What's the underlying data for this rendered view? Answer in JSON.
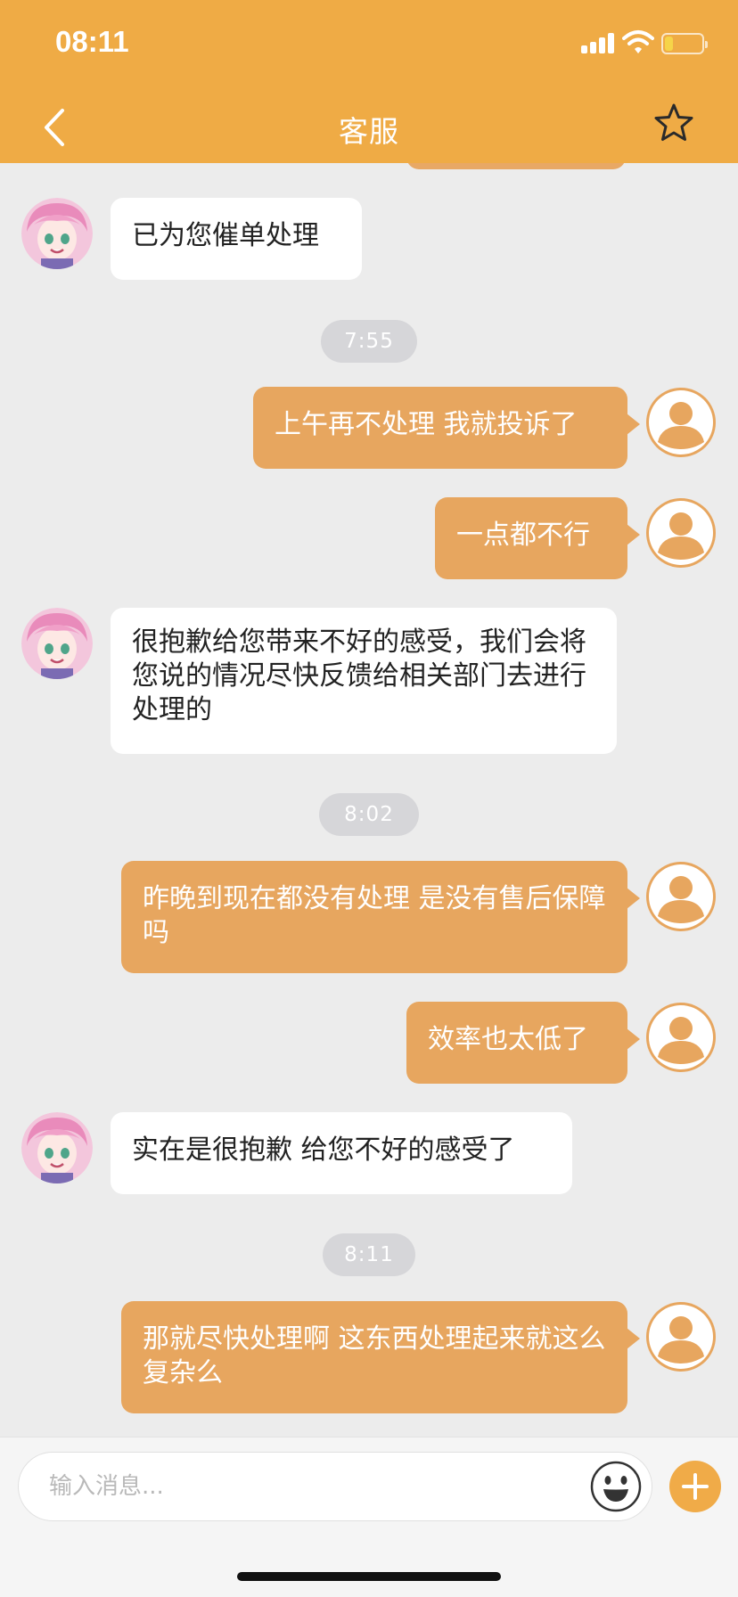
{
  "status": {
    "time": "08:11"
  },
  "header": {
    "title": "客服"
  },
  "colors": {
    "accent": "#efab45",
    "out_bubble": "#e7a65f",
    "in_bubble": "#ffffff",
    "background": "#ececec"
  },
  "icons": {
    "back": "chevron-left-icon",
    "favorite": "star-icon",
    "emoji": "smiley-icon",
    "add": "plus-icon"
  },
  "messages": [
    {
      "from": "agent",
      "text": "已为您催单处理"
    },
    {
      "time": "7:55"
    },
    {
      "from": "user",
      "text": "上午再不处理 我就投诉了"
    },
    {
      "from": "user",
      "text": "一点都不行"
    },
    {
      "from": "agent",
      "text": "很抱歉给您带来不好的感受，我们会将您说的情况尽快反馈给相关部门去进行处理的"
    },
    {
      "time": "8:02"
    },
    {
      "from": "user",
      "text": "昨晚到现在都没有处理 是没有售后保障吗"
    },
    {
      "from": "user",
      "text": "效率也太低了"
    },
    {
      "from": "agent",
      "text": "实在是很抱歉 给您不好的感受了"
    },
    {
      "time": "8:11"
    },
    {
      "from": "user",
      "text": "那就尽快处理啊 这东西处理起来就这么复杂么"
    }
  ],
  "input": {
    "placeholder": "输入消息...",
    "value": ""
  }
}
